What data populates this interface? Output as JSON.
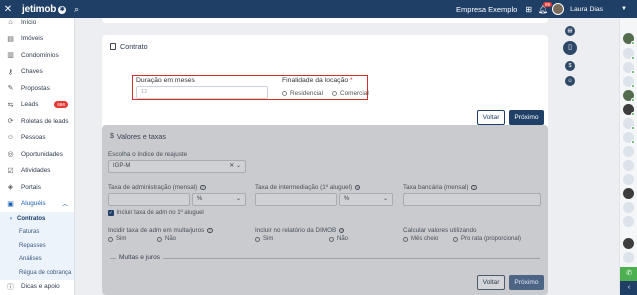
{
  "topbar": {
    "close_icon": "close-icon",
    "logo": "jetimob",
    "logo_mark": "✱",
    "company": "Empresa Exemplo",
    "notifications": "99",
    "user": "Laura Dias"
  },
  "sidebar": {
    "items": [
      {
        "label": "Início",
        "icon": "home-icon",
        "glyph": "⌂"
      },
      {
        "label": "Imóveis",
        "icon": "building-icon",
        "glyph": "▤"
      },
      {
        "label": "Condomínios",
        "icon": "condo-icon",
        "glyph": "▥"
      },
      {
        "label": "Chaves",
        "icon": "key-icon",
        "glyph": "⚷"
      },
      {
        "label": "Propostas",
        "icon": "proposal-icon",
        "glyph": "✎"
      },
      {
        "label": "Leads",
        "icon": "leads-icon",
        "glyph": "⇆",
        "badge": "696"
      },
      {
        "label": "Roletas de leads",
        "icon": "roulette-icon",
        "glyph": "⟳"
      },
      {
        "label": "Pessoas",
        "icon": "people-icon",
        "glyph": "☺"
      },
      {
        "label": "Oportunidades",
        "icon": "opportunity-icon",
        "glyph": "◎"
      },
      {
        "label": "Atividades",
        "icon": "activity-icon",
        "glyph": "☑"
      },
      {
        "label": "Portais",
        "icon": "portal-icon",
        "glyph": "◈"
      },
      {
        "label": "Aluguéis",
        "icon": "rental-icon",
        "glyph": "▣"
      }
    ],
    "subitems": [
      {
        "label": "Contratos"
      },
      {
        "label": "Faturas"
      },
      {
        "label": "Repasses"
      },
      {
        "label": "Análises"
      },
      {
        "label": "Régua de cobrança"
      }
    ],
    "footer": {
      "label": "Dicas e apoio",
      "icon": "help-icon"
    }
  },
  "contrato": {
    "title": "Contrato",
    "duracao_label": "Duração em meses",
    "duracao_placeholder": "12",
    "finalidade_label": "Finalidade da locação",
    "required_mark": "*",
    "opt_residencial": "Residencial",
    "opt_comercial": "Comercial",
    "voltar": "Voltar",
    "proximo": "Próximo"
  },
  "valores": {
    "title": "Valores e taxas",
    "reajuste_label": "Escolha o índice de reajuste",
    "reajuste_value": "IGP-M",
    "taxa_adm_label": "Taxa de administração (mensal)",
    "taxa_inter_label": "Taxa de intermediação (1º aluguel)",
    "taxa_banc_label": "Taxa bancária (mensal)",
    "percent": "%",
    "incluir_chk": "Incluir taxa de adm no 1º aluguel",
    "incidir_label": "Incidir taxa de adm em multa/juros",
    "dimob_label": "Incluir no relatório da DIMOB",
    "calcular_label": "Calcular valores utilizando",
    "sim": "Sim",
    "nao": "Não",
    "mes_cheio": "Mês cheio",
    "pro_rata": "Pro rata (proporcional)",
    "multas": "Multas e juros",
    "voltar": "Voltar",
    "proximo": "Próximo"
  },
  "steps": [
    {
      "icon": "building-step-icon",
      "glyph": "▤"
    },
    {
      "icon": "document-step-icon",
      "glyph": "▯"
    },
    {
      "icon": "dollar-step-icon",
      "glyph": "$"
    },
    {
      "icon": "people-step-icon",
      "glyph": "☺"
    }
  ],
  "colors": {
    "primary": "#1f3f66",
    "required": "#d32f2f",
    "badge": "#e53935",
    "online": "#4caf50"
  }
}
